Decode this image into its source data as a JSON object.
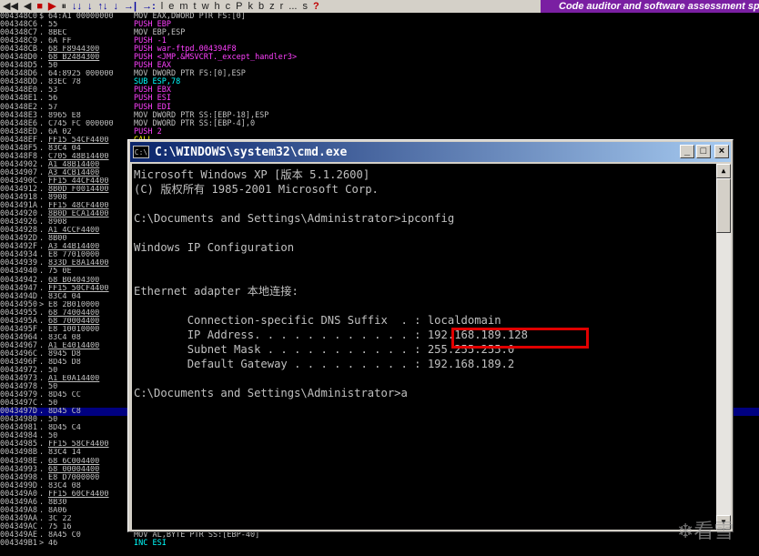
{
  "toolbar": {
    "buttons": [
      "◀◀",
      "◀",
      "■",
      "▶",
      "⏸",
      "↓↓",
      "↓",
      "↑↓",
      "↓",
      "→|",
      "→:",
      "l",
      "e",
      "m",
      "t",
      "w",
      "h",
      "c",
      "P",
      "k",
      "b",
      "z",
      "r",
      "...",
      "s",
      "?"
    ],
    "title": "Code auditor and software assessment specialist"
  },
  "disassembly": {
    "rows": [
      {
        "addr": "004348C0",
        "mark": "$",
        "hex": "64:A1 00000000",
        "mn": "MOV",
        "ops": "EAX,DWORD PTR FS:[0]",
        "cls": "c-mov"
      },
      {
        "addr": "004348C6",
        "mark": ".",
        "hex": "55",
        "mn": "PUSH",
        "ops": "EBP",
        "cls": "c-push"
      },
      {
        "addr": "004348C7",
        "mark": ".",
        "hex": "8BEC",
        "mn": "MOV",
        "ops": "EBP,ESP",
        "cls": "c-mov"
      },
      {
        "addr": "004348C9",
        "mark": ".",
        "hex": "6A FF",
        "mn": "PUSH",
        "ops": "-1",
        "cls": "c-push"
      },
      {
        "addr": "004348CB",
        "mark": ".",
        "hex": "68 F8944300",
        "mn": "PUSH",
        "ops": "war-ftpd.004394F8",
        "cls": "c-push",
        "und": true
      },
      {
        "addr": "004348D0",
        "mark": ".",
        "hex": "68 B2484300",
        "mn": "PUSH",
        "ops": "<JMP.&MSVCRT._except_handler3>",
        "cls": "c-push",
        "und": true
      },
      {
        "addr": "004348D5",
        "mark": ".",
        "hex": "50",
        "mn": "PUSH",
        "ops": "EAX",
        "cls": "c-push"
      },
      {
        "addr": "004348D6",
        "mark": ".",
        "hex": "64:8925 000000",
        "mn": "MOV",
        "ops": "DWORD PTR FS:[0],ESP",
        "cls": "c-mov"
      },
      {
        "addr": "004348DD",
        "mark": ".",
        "hex": "83EC 78",
        "mn": "SUB",
        "ops": "ESP,78",
        "cls": "c-sub"
      },
      {
        "addr": "004348E0",
        "mark": ".",
        "hex": "53",
        "mn": "PUSH",
        "ops": "EBX",
        "cls": "c-push"
      },
      {
        "addr": "004348E1",
        "mark": ".",
        "hex": "56",
        "mn": "PUSH",
        "ops": "ESI",
        "cls": "c-push"
      },
      {
        "addr": "004348E2",
        "mark": ".",
        "hex": "57",
        "mn": "PUSH",
        "ops": "EDI",
        "cls": "c-push"
      },
      {
        "addr": "004348E3",
        "mark": ".",
        "hex": "8965 E8",
        "mn": "MOV",
        "ops": "DWORD PTR SS:[EBP-18],ESP",
        "cls": "c-mov"
      },
      {
        "addr": "004348E6",
        "mark": ".",
        "hex": "C745 FC 000000",
        "mn": "MOV",
        "ops": "DWORD PTR SS:[EBP-4],0",
        "cls": "c-mov"
      },
      {
        "addr": "004348ED",
        "mark": ".",
        "hex": "6A 02",
        "mn": "PUSH",
        "ops": "2",
        "cls": "c-push"
      },
      {
        "addr": "004348EF",
        "mark": ".",
        "hex": "FF15 54CF4400",
        "mn": "CALL",
        "ops": "",
        "cls": "c-call",
        "und": true
      },
      {
        "addr": "004348F5",
        "mark": ".",
        "hex": "83C4 04",
        "mn": "",
        "ops": "",
        "cls": "c-mov"
      },
      {
        "addr": "004348F8",
        "mark": ".",
        "hex": "C705 48B14400",
        "mn": "",
        "ops": "",
        "cls": "c-mov",
        "und": true
      },
      {
        "addr": "00434902",
        "mark": ".",
        "hex": "A1 48B14400",
        "mn": "",
        "ops": "",
        "cls": "c-mov",
        "und": true
      },
      {
        "addr": "00434907",
        "mark": ".",
        "hex": "A3 4CB14400",
        "mn": "",
        "ops": "",
        "cls": "c-mov",
        "und": true
      },
      {
        "addr": "0043490C",
        "mark": ".",
        "hex": "FF15 44CF4400",
        "mn": "",
        "ops": "",
        "cls": "c-mov",
        "und": true
      },
      {
        "addr": "00434912",
        "mark": ".",
        "hex": "8B0D F0014400",
        "mn": "",
        "ops": "",
        "cls": "c-mov",
        "und": true
      },
      {
        "addr": "00434918",
        "mark": ".",
        "hex": "8908",
        "mn": "",
        "ops": "",
        "cls": "c-mov"
      },
      {
        "addr": "0043491A",
        "mark": ".",
        "hex": "FF15 48CF4400",
        "mn": "",
        "ops": "",
        "cls": "c-mov",
        "und": true
      },
      {
        "addr": "00434920",
        "mark": ".",
        "hex": "8B0D ECA14400",
        "mn": "",
        "ops": "",
        "cls": "c-mov",
        "und": true
      },
      {
        "addr": "00434926",
        "mark": ".",
        "hex": "8908",
        "mn": "",
        "ops": "",
        "cls": "c-mov"
      },
      {
        "addr": "00434928",
        "mark": ".",
        "hex": "A1 4CCF4400",
        "mn": "",
        "ops": "",
        "cls": "c-mov",
        "und": true
      },
      {
        "addr": "0043492D",
        "mark": ".",
        "hex": "8B00",
        "mn": "",
        "ops": "",
        "cls": "c-mov"
      },
      {
        "addr": "0043492F",
        "mark": ".",
        "hex": "A3 44B14400",
        "mn": "",
        "ops": "",
        "cls": "c-mov",
        "und": true
      },
      {
        "addr": "00434934",
        "mark": ".",
        "hex": "E8 77010000",
        "mn": "",
        "ops": "",
        "cls": "c-mov"
      },
      {
        "addr": "00434939",
        "mark": ".",
        "hex": "833D E8A14400",
        "mn": "",
        "ops": "",
        "cls": "c-mov",
        "und": true
      },
      {
        "addr": "00434940",
        "mark": ".",
        "hex": "75 0E",
        "mn": "",
        "ops": "",
        "cls": "c-mov"
      },
      {
        "addr": "00434942",
        "mark": ".",
        "hex": "68 B0404300",
        "mn": "",
        "ops": "",
        "cls": "c-mov",
        "und": true
      },
      {
        "addr": "00434947",
        "mark": ".",
        "hex": "FF15 50CF4400",
        "mn": "",
        "ops": "",
        "cls": "c-mov",
        "und": true
      },
      {
        "addr": "0043494D",
        "mark": ".",
        "hex": "83C4 04",
        "mn": "",
        "ops": "",
        "cls": "c-mov"
      },
      {
        "addr": "00434950",
        "mark": ">",
        "hex": "E8 2B010000",
        "mn": "",
        "ops": "",
        "cls": "c-mov"
      },
      {
        "addr": "00434955",
        "mark": ".",
        "hex": "68 74004400",
        "mn": "",
        "ops": "",
        "cls": "c-mov",
        "und": true
      },
      {
        "addr": "0043495A",
        "mark": ".",
        "hex": "68 70004400",
        "mn": "",
        "ops": "",
        "cls": "c-mov",
        "und": true
      },
      {
        "addr": "0043495F",
        "mark": ".",
        "hex": "E8 10010000",
        "mn": "",
        "ops": "",
        "cls": "c-mov"
      },
      {
        "addr": "00434964",
        "mark": ".",
        "hex": "83C4 08",
        "mn": "",
        "ops": "",
        "cls": "c-mov"
      },
      {
        "addr": "00434967",
        "mark": ".",
        "hex": "A1 E4014400",
        "mn": "",
        "ops": "",
        "cls": "c-mov",
        "und": true
      },
      {
        "addr": "0043496C",
        "mark": ".",
        "hex": "8945 D8",
        "mn": "",
        "ops": "",
        "cls": "c-mov"
      },
      {
        "addr": "0043496F",
        "mark": ".",
        "hex": "8D45 D8",
        "mn": "",
        "ops": "",
        "cls": "c-mov"
      },
      {
        "addr": "00434972",
        "mark": ".",
        "hex": "50",
        "mn": "",
        "ops": "",
        "cls": "c-mov"
      },
      {
        "addr": "00434973",
        "mark": ".",
        "hex": "A1 E0A14400",
        "mn": "",
        "ops": "",
        "cls": "c-mov",
        "und": true
      },
      {
        "addr": "00434978",
        "mark": ".",
        "hex": "50",
        "mn": "",
        "ops": "",
        "cls": "c-mov"
      },
      {
        "addr": "00434979",
        "mark": ".",
        "hex": "8D45 CC",
        "mn": "",
        "ops": "",
        "cls": "c-mov"
      },
      {
        "addr": "0043497C",
        "mark": ".",
        "hex": "50",
        "mn": "",
        "ops": "",
        "cls": "c-mov"
      },
      {
        "addr": "0043497D",
        "mark": ".",
        "hex": "8D45 C8",
        "mn": "",
        "ops": "",
        "cls": "c-mov",
        "sel": true
      },
      {
        "addr": "00434980",
        "mark": ".",
        "hex": "50",
        "mn": "",
        "ops": "",
        "cls": "c-mov"
      },
      {
        "addr": "00434981",
        "mark": ".",
        "hex": "8D45 C4",
        "mn": "",
        "ops": "",
        "cls": "c-mov"
      },
      {
        "addr": "00434984",
        "mark": ".",
        "hex": "50",
        "mn": "",
        "ops": "",
        "cls": "c-mov"
      },
      {
        "addr": "00434985",
        "mark": ".",
        "hex": "FF15 58CF4400",
        "mn": "",
        "ops": "",
        "cls": "c-mov",
        "und": true
      },
      {
        "addr": "0043498B",
        "mark": ".",
        "hex": "83C4 14",
        "mn": "",
        "ops": "",
        "cls": "c-mov"
      },
      {
        "addr": "0043498E",
        "mark": ".",
        "hex": "68 6C004400",
        "mn": "",
        "ops": "",
        "cls": "c-mov",
        "und": true
      },
      {
        "addr": "00434993",
        "mark": ".",
        "hex": "68 00004400",
        "mn": "",
        "ops": "",
        "cls": "c-mov",
        "und": true
      },
      {
        "addr": "00434998",
        "mark": ".",
        "hex": "E8 D7000000",
        "mn": "",
        "ops": "",
        "cls": "c-mov"
      },
      {
        "addr": "0043499D",
        "mark": ".",
        "hex": "83C4 08",
        "mn": "",
        "ops": "",
        "cls": "c-mov"
      },
      {
        "addr": "004349A0",
        "mark": ".",
        "hex": "FF15 60CF4400",
        "mn": "",
        "ops": "",
        "cls": "c-mov",
        "und": true
      },
      {
        "addr": "004349A6",
        "mark": ".",
        "hex": "8B30",
        "mn": "",
        "ops": "",
        "cls": "c-mov"
      },
      {
        "addr": "004349A8",
        "mark": ".",
        "hex": "8A06",
        "mn": "",
        "ops": "",
        "cls": "c-mov"
      },
      {
        "addr": "004349AA",
        "mark": ".",
        "hex": "3C 22",
        "mn": "",
        "ops": "",
        "cls": "c-mov"
      },
      {
        "addr": "004349AC",
        "mark": ".",
        "hex": "75 16",
        "mn": "",
        "ops": "",
        "cls": "c-mov"
      },
      {
        "addr": "004349AE",
        "mark": ".",
        "hex": "8A45 C0",
        "mn": "MOV",
        "ops": "AL,BYTE PTR SS:[EBP-40]",
        "cls": "c-mov"
      },
      {
        "addr": "004349B1",
        "mark": ">",
        "hex": "46",
        "mn": "INC",
        "ops": "ESI",
        "cls": "c-sub"
      }
    ]
  },
  "cmd": {
    "title": "C:\\WINDOWS\\system32\\cmd.exe",
    "icon_text": "C:\\",
    "window_buttons": {
      "minimize": "_",
      "maximize": "□",
      "close": "×"
    },
    "lines": [
      "Microsoft Windows XP [版本 5.1.2600]",
      "(C) 版权所有 1985-2001 Microsoft Corp.",
      "",
      "C:\\Documents and Settings\\Administrator>ipconfig",
      "",
      "Windows IP Configuration",
      "",
      "",
      "Ethernet adapter 本地连接:",
      "",
      "        Connection-specific DNS Suffix  . : localdomain",
      "        IP Address. . . . . . . . . . . . : 192.168.189.128",
      "        Subnet Mask . . . . . . . . . . . : 255.255.255.0",
      "        Default Gateway . . . . . . . . . : 192.168.189.2",
      "",
      "C:\\Documents and Settings\\Administrator>a"
    ],
    "scroll_up": "▲",
    "scroll_down": "▼"
  },
  "watermark": "❄看雪"
}
